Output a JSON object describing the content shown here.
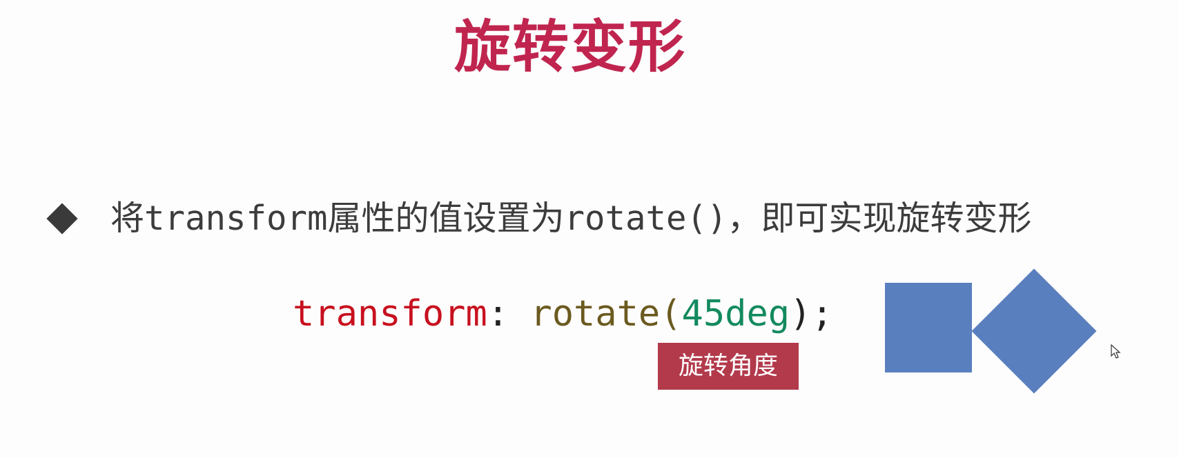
{
  "slide": {
    "title": "旋转变形",
    "bullet": {
      "marker": "diamond-bullet-icon",
      "text": "将transform属性的值设置为rotate()，即可实现旋转变形"
    },
    "code": {
      "property": "transform",
      "colon": ": ",
      "function": "rotate",
      "open_paren": "(",
      "argument": "45deg",
      "close_paren": ");"
    },
    "annotation_tag": "旋转角度",
    "demo": {
      "before_shape": "square",
      "after_shape": "rotated-square",
      "rotation_degrees": 45,
      "shape_color": "#5a7fbe"
    },
    "colors": {
      "title": "#c0254f",
      "code_property": "#c8101e",
      "code_function": "#6b5a1f",
      "code_number": "#138a5e",
      "tag_background": "#b23a4b"
    }
  }
}
